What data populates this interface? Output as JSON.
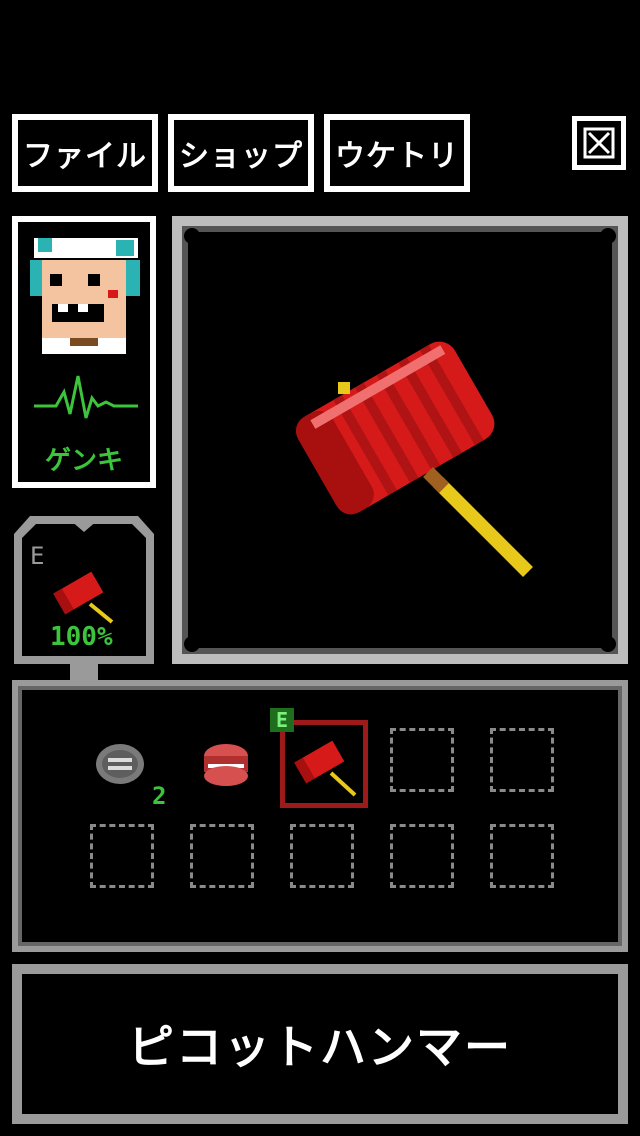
{
  "menu": {
    "file_label": "ファイル",
    "shop_label": "ショップ",
    "receive_label": "ウケトリ"
  },
  "portrait": {
    "status_label": "ゲンキ"
  },
  "equipped": {
    "marker": "E",
    "durability": "100%"
  },
  "inventory": {
    "slots": [
      {
        "item": "coin",
        "count": "2"
      },
      {
        "item": "chatter-teeth",
        "count": ""
      },
      {
        "item": "hammer",
        "count": "",
        "equipped_marker": "E"
      },
      {
        "item": "",
        "count": ""
      },
      {
        "item": "",
        "count": ""
      },
      {
        "item": "",
        "count": ""
      },
      {
        "item": "",
        "count": ""
      },
      {
        "item": "",
        "count": ""
      },
      {
        "item": "",
        "count": ""
      },
      {
        "item": "",
        "count": ""
      }
    ]
  },
  "selected_item": {
    "name": "ピコットハンマー"
  },
  "colors": {
    "accent_green": "#3cc43c",
    "hammer_red": "#d61a1a",
    "selection_border": "#9c1a1a"
  }
}
